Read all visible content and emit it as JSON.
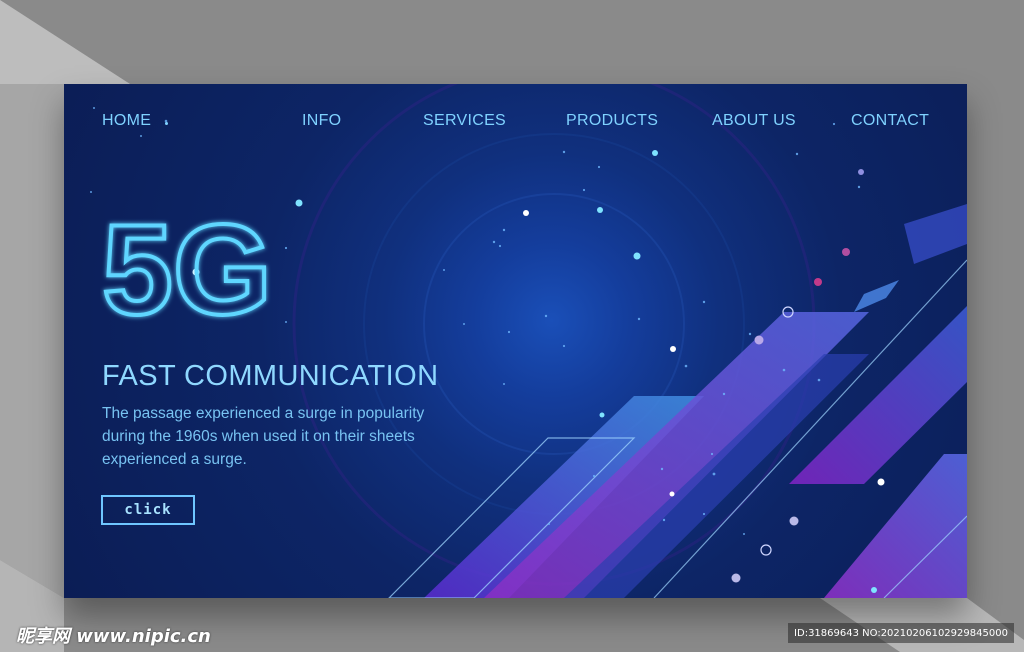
{
  "nav": {
    "items": [
      {
        "label": "HOME"
      },
      {
        "label": "INFO"
      },
      {
        "label": "SERVICES"
      },
      {
        "label": "PRODUCTS"
      },
      {
        "label": "ABOUT US"
      },
      {
        "label": "CONTACT"
      }
    ]
  },
  "hero": {
    "big_text": "5G",
    "headline": "FAST COMMUNICATION",
    "description": "The passage experienced a surge in popularity during the 1960s when used it on their sheets experienced a surge.",
    "button_label": "click"
  },
  "watermark": {
    "site": "昵享网 www.nipic.cn",
    "id_text": "ID:31869643 NO:20210206102929845000"
  },
  "colors": {
    "page_bg": "#8a8a8a",
    "card_dark": "#0b1d55",
    "card_glow": "#1a4fb8",
    "accent_cyan": "#7fd2ff",
    "accent_purple": "#8a2fc4"
  }
}
